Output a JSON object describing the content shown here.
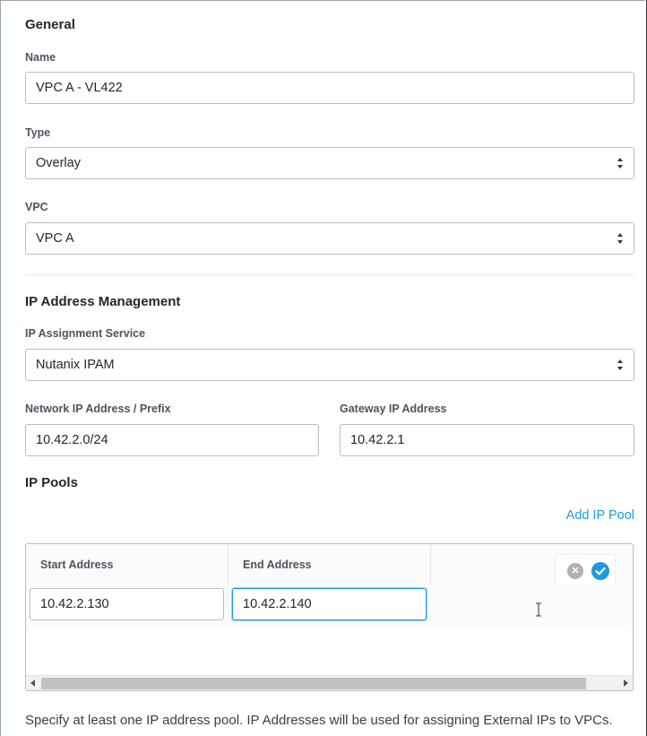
{
  "general": {
    "heading": "General",
    "name": {
      "label": "Name",
      "value": "VPC A - VL422"
    },
    "type": {
      "label": "Type",
      "value": "Overlay"
    },
    "vpc": {
      "label": "VPC",
      "value": "VPC A"
    }
  },
  "ipam": {
    "heading": "IP Address Management",
    "service": {
      "label": "IP Assignment Service",
      "value": "Nutanix IPAM"
    },
    "network": {
      "label": "Network IP Address / Prefix",
      "value": "10.42.2.0/24"
    },
    "gateway": {
      "label": "Gateway IP Address",
      "value": "10.42.2.1"
    }
  },
  "pools": {
    "heading": "IP Pools",
    "add_link": "Add IP Pool",
    "columns": [
      "Start Address",
      "End Address"
    ],
    "rows": [
      {
        "start": "10.42.2.130",
        "end": "10.42.2.140"
      }
    ],
    "hint": "Specify at least one IP address pool. IP Addresses will be used for assigning External IPs to VPCs."
  },
  "colors": {
    "accent": "#1b9bd8",
    "label": "#4b5560",
    "border": "#b9bec4"
  },
  "icons": [
    "select-arrows-icon",
    "cancel-row-icon",
    "confirm-row-icon",
    "scroll-left-icon",
    "scroll-right-icon",
    "text-cursor-icon"
  ]
}
